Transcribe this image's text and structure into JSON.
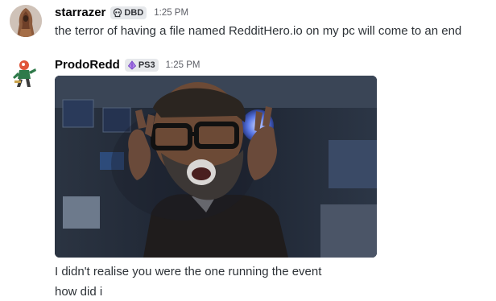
{
  "messages": [
    {
      "username": "starrazer",
      "tag": "DBD",
      "tag_icon": "skull-icon",
      "timestamp": "1:25 PM",
      "lines": [
        "the terror of having a file named RedditHero.io on my pc will come to an end"
      ]
    },
    {
      "username": "ProdoRedd",
      "tag": "PS3",
      "tag_icon": "gem-icon",
      "timestamp": "1:25 PM",
      "attachment": "gif",
      "lines": [
        "I didn't realise you were the one running the event",
        "how did i"
      ]
    }
  ],
  "colors": {
    "background": "#ffffff",
    "username": "#060607",
    "text": "#2e3338",
    "timestamp": "#5c5e66",
    "tag_bg": "#e6e8eb",
    "gem": "#8f5bd9"
  }
}
